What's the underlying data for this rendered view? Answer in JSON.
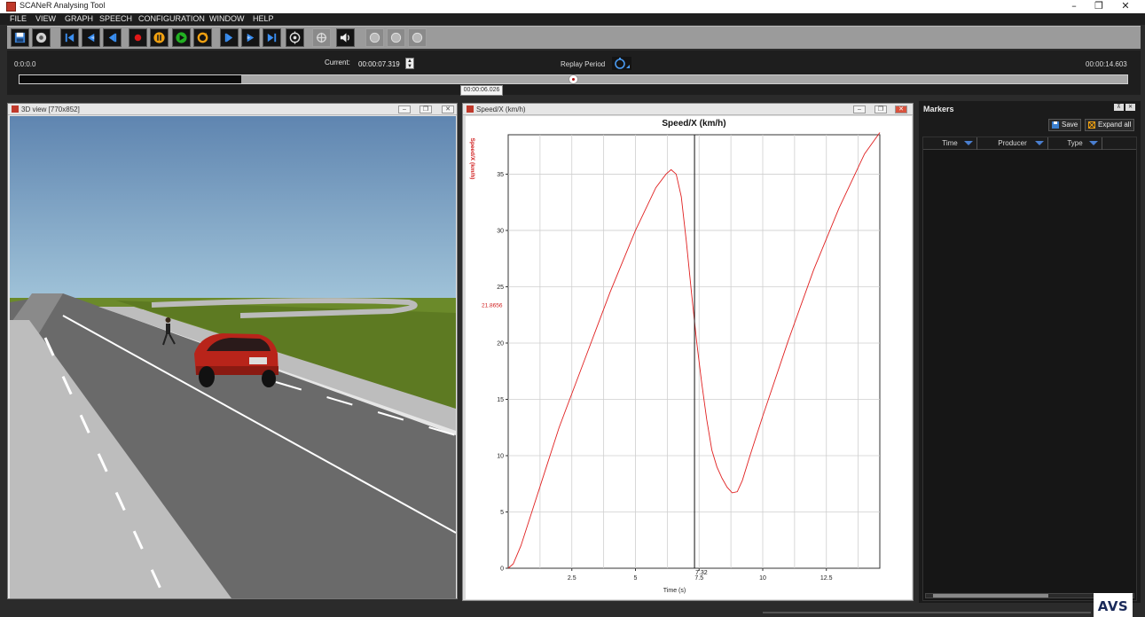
{
  "window": {
    "title": "SCANeR Analysing Tool",
    "controls": {
      "minimize": "–",
      "restore": "❐",
      "close": "✕"
    }
  },
  "menu": [
    "FILE",
    "VIEW",
    "GRAPH",
    "SPEECH",
    "CONFIGURATION",
    "WINDOW",
    "HELP"
  ],
  "toolbar": {
    "icons": [
      "save-icon",
      "settings-icon",
      "go-to-start-icon",
      "step-back-icon",
      "play-backward-icon",
      "record-icon",
      "pause-icon",
      "play-icon",
      "loop-icon",
      "play-forward-icon",
      "step-forward-icon",
      "go-to-end-icon",
      "camera-target-icon",
      "crosshair-icon",
      "sound-icon",
      "zoom-icon",
      "zoom-reset-icon",
      "zoom-out-icon"
    ]
  },
  "timeline": {
    "start": "0:0:0.0",
    "current_label": "Current:",
    "current_value": "00:00:07.319",
    "replay_label": "Replay Period",
    "end": "00:00:14.603",
    "tooltip": "00:00:06.026",
    "played_fraction": 0.2,
    "knob_fraction": 0.5
  },
  "view3d": {
    "title": "3D view [770x852]"
  },
  "graph": {
    "title": "Speed/X (km/h)"
  },
  "chart_data": {
    "type": "line",
    "title": "Speed/X (km/h)",
    "xlabel": "Time (s)",
    "ylabel": "Speed/X (km/h)",
    "xlim": [
      0,
      14.6
    ],
    "ylim": [
      0,
      38.5
    ],
    "xticks": [
      2.5,
      5,
      7.5,
      10,
      12.5
    ],
    "xtick_labels": [
      "2.5",
      "5",
      "7.5",
      "10",
      "12.5"
    ],
    "yticks": [
      0,
      5,
      10,
      15,
      20,
      25,
      30,
      35
    ],
    "ytick_labels": [
      "0",
      "5",
      "10",
      "15",
      "20",
      "25",
      "30",
      "35"
    ],
    "grid": true,
    "cursor": {
      "x": 7.32,
      "label": "7.32",
      "y_value_label": "21.8656"
    },
    "series": [
      {
        "color": "#e02020",
        "x": [
          0,
          0.2,
          0.5,
          1.0,
          1.5,
          2.0,
          3.0,
          4.0,
          5.0,
          5.8,
          6.2,
          6.4,
          6.6,
          6.8,
          7.0,
          7.2,
          7.4,
          7.6,
          7.8,
          8.0,
          8.2,
          8.4,
          8.6,
          8.8,
          9.0,
          9.2,
          9.5,
          10.0,
          11.0,
          12.0,
          13.0,
          14.0,
          14.6
        ],
        "y": [
          0,
          0.4,
          2.0,
          5.5,
          9.0,
          12.5,
          18.5,
          24.5,
          30.0,
          33.8,
          35.0,
          35.4,
          35.0,
          33.0,
          29.0,
          24.5,
          20.2,
          16.5,
          13.2,
          10.5,
          9.0,
          8.0,
          7.2,
          6.7,
          6.8,
          7.8,
          10.0,
          13.5,
          20.2,
          26.5,
          32.0,
          36.8,
          38.7
        ]
      }
    ]
  },
  "markers": {
    "title": "Markers",
    "save_label": "Save",
    "expand_label": "Expand all",
    "columns": [
      "Time",
      "Producer",
      "Type"
    ]
  },
  "logo": "AVS"
}
